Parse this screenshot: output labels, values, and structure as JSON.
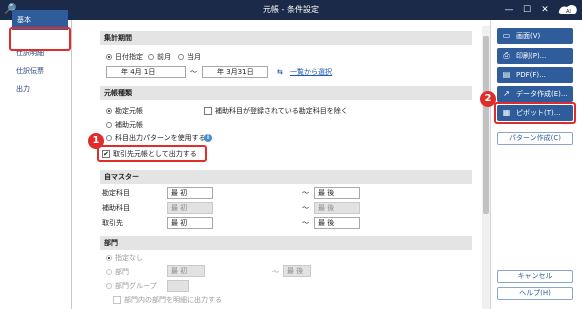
{
  "window": {
    "title": "元帳 - 条件設定",
    "left_glyph": "🔎+",
    "min_glyph": "—",
    "max_glyph": "☐",
    "close_glyph": "✕",
    "logo_text": "AI"
  },
  "sidebar": {
    "items": [
      {
        "label": "基本"
      },
      {
        "label": "仕訳明細"
      },
      {
        "label": "仕訳伝票"
      },
      {
        "label": "出力"
      }
    ]
  },
  "period": {
    "header": "集計期間",
    "opt_date": "日付指定",
    "opt_prev": "前月",
    "opt_curr": "当月",
    "from_value": "年  4月  1日",
    "tilde": "〜",
    "to_value": "年  3月31日",
    "swap_glyph": "⇆",
    "link": "一覧から選択"
  },
  "ledger": {
    "header": "元帳種類",
    "opt_kanjo": "勘定元帳",
    "opt_hojo": "補助元帳",
    "chk_exclude_label": "補助科目が登録されている勘定科目を除く",
    "opt_pattern": "科目出力パターンを使用する",
    "info_glyph": "i",
    "chk_torihiki_label": "取引先元帳として出力する",
    "chk_torihiki_glyph": "✔"
  },
  "master": {
    "header": "自マスター",
    "rows": [
      {
        "label": "勘定科目",
        "from": "最 初",
        "tilde": "〜",
        "to": "最 後"
      },
      {
        "label": "補助科目",
        "from": "最 初",
        "tilde": "〜",
        "to": "最 後"
      },
      {
        "label": "取引先",
        "from": "最 初",
        "tilde": "〜",
        "to": "最 後"
      }
    ]
  },
  "dept": {
    "header": "部門",
    "opt_none": "指定なし",
    "opt_bumon": "部門",
    "bumon_from": "最 初",
    "tilde": "〜",
    "bumon_to": "最 後",
    "opt_group": "部門グループ",
    "cut_text": "部門内の部門を明細に出力する"
  },
  "actions": {
    "screen": "画面(V)",
    "print": "印刷(P)...",
    "pdf": "PDF(F)...",
    "data": "データ作成(E)...",
    "pivot": "ピボット(T)...",
    "pattern": "パターン作成(C)",
    "cancel": "キャンセル",
    "help": "ヘルプ(H)"
  },
  "callouts": {
    "one": "1",
    "two": "2"
  },
  "colors": {
    "titlebar": "#1b2a49",
    "accent": "#2f5d9c",
    "highlight": "#e12c2c"
  }
}
